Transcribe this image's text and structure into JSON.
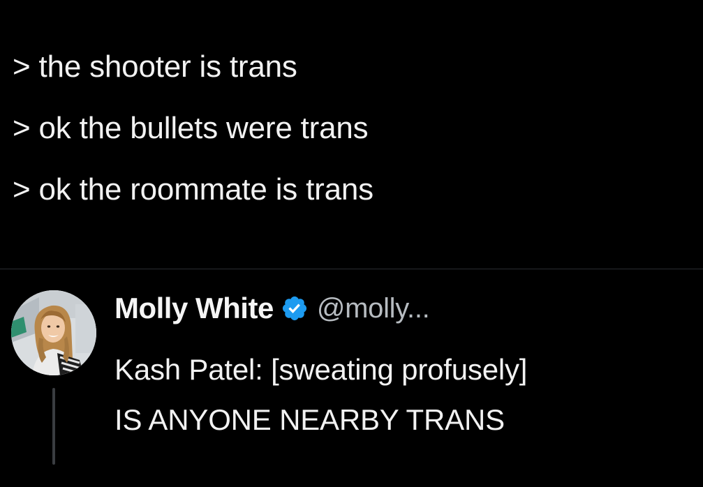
{
  "quote": {
    "lines": [
      "> the shooter is trans",
      "> ok the bullets were trans",
      "> ok the roommate is trans"
    ]
  },
  "tweet": {
    "author_name": "Molly White",
    "verified_icon": "verified-badge-icon",
    "handle": "@molly...",
    "text_lines": [
      "Kash Patel: [sweating profusely]",
      "IS ANYONE NEARBY TRANS"
    ]
  },
  "colors": {
    "background": "#000000",
    "text": "#f2f2f2",
    "handle": "#b7bcc1",
    "verified": "#1d9bf0",
    "divider": "#2a2d31"
  }
}
